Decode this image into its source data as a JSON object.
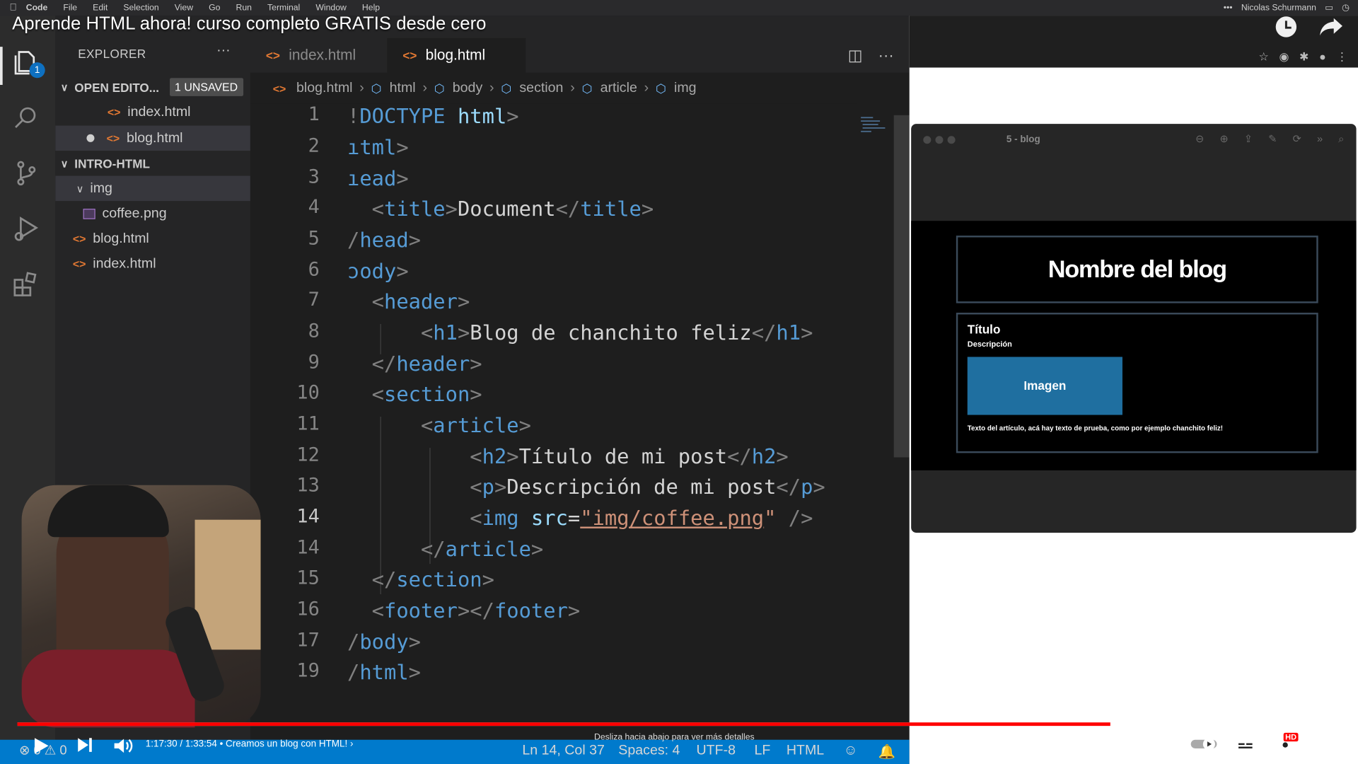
{
  "menubar": {
    "app": "Code",
    "items": [
      "File",
      "Edit",
      "Selection",
      "View",
      "Go",
      "Run",
      "Terminal",
      "Window",
      "Help"
    ],
    "user": "Nicolas Schurmann"
  },
  "video": {
    "title": "Aprende HTML ahora! curso completo GRATIS desde cero",
    "time": "1:17:30 / 1:33:54",
    "chapter": "Creamos un blog con HTML!",
    "scroll_hint": "Desliza hacia abajo para ver más detalles",
    "progress_fraction": 0.826,
    "buffer_fraction": 0.839,
    "hd_badge": "HD"
  },
  "activity": {
    "badge": "1"
  },
  "explorer": {
    "title": "EXPLORER",
    "more": "···",
    "open_editors": "OPEN EDITO...",
    "unsaved": "1 UNSAVED",
    "open_files": [
      "index.html",
      "blog.html"
    ],
    "project": "INTRO-HTML",
    "folder": "img",
    "folder_file": "coffee.png",
    "files": [
      "blog.html",
      "index.html"
    ]
  },
  "tabs": [
    {
      "label": "index.html"
    },
    {
      "label": "blog.html"
    }
  ],
  "breadcrumb": [
    "blog.html",
    "html",
    "body",
    "section",
    "article",
    "img"
  ],
  "editor": {
    "line_numbers": [
      "1",
      "2",
      "3",
      "4",
      "5",
      "6",
      "7",
      "8",
      "9",
      "10",
      "11",
      "12",
      "13",
      "14",
      "15",
      "16",
      "17",
      "19"
    ],
    "current_line": "14"
  },
  "status": {
    "errors": "0",
    "warnings": "0",
    "position": "Ln 14, Col 37",
    "spaces": "Spaces: 4",
    "encoding": "UTF-8",
    "eol": "LF",
    "language": "HTML"
  },
  "preview": {
    "window_title": "5 - blog",
    "blog_name": "Nombre del blog",
    "article_title": "Título",
    "article_desc": "Descripción",
    "image_label": "Imagen",
    "article_text": "Texto del artículo, acá hay texto de prueba, como por ejemplo chanchito feliz!"
  },
  "colors": {
    "accent": "#007acc",
    "progress": "#ff0000",
    "tag": "#569cd6",
    "attr": "#9cdcfe",
    "string": "#ce9178"
  }
}
